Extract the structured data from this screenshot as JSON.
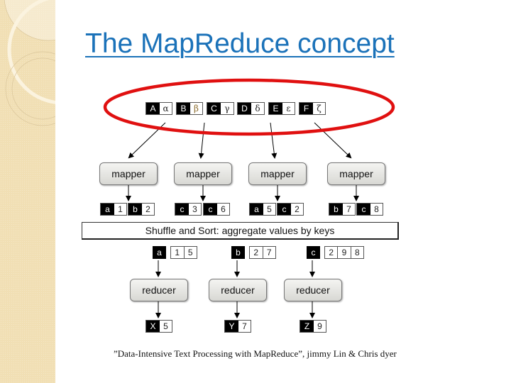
{
  "slide": {
    "title": "The MapReduce concept",
    "caption": "”Data-Intensive Text Processing with MapReduce”, jimmy Lin & Chris dyer",
    "colors": {
      "title": "#1b72b9",
      "highlight_ellipse": "#e01010",
      "background_strip": "#f1dfb4"
    }
  },
  "diagram": {
    "inputs": [
      {
        "key": "A",
        "value": "α"
      },
      {
        "key": "B",
        "value": "β"
      },
      {
        "key": "C",
        "value": "γ"
      },
      {
        "key": "D",
        "value": "δ"
      },
      {
        "key": "E",
        "value": "ε"
      },
      {
        "key": "F",
        "value": "ζ"
      }
    ],
    "mappers": [
      {
        "label": "mapper",
        "outputs": [
          {
            "key": "a",
            "value": "1"
          },
          {
            "key": "b",
            "value": "2"
          }
        ]
      },
      {
        "label": "mapper",
        "outputs": [
          {
            "key": "c",
            "value": "3"
          },
          {
            "key": "c",
            "value": "6"
          }
        ]
      },
      {
        "label": "mapper",
        "outputs": [
          {
            "key": "a",
            "value": "5"
          },
          {
            "key": "c",
            "value": "2"
          }
        ]
      },
      {
        "label": "mapper",
        "outputs": [
          {
            "key": "b",
            "value": "7"
          },
          {
            "key": "c",
            "value": "8"
          }
        ]
      }
    ],
    "shuffle_label": "Shuffle and Sort: aggregate values by keys",
    "groups": [
      {
        "key": "a",
        "values": [
          "1",
          "5"
        ]
      },
      {
        "key": "b",
        "values": [
          "2",
          "7"
        ]
      },
      {
        "key": "c",
        "values": [
          "2",
          "9",
          "8"
        ]
      }
    ],
    "reducers": [
      {
        "label": "reducer",
        "output": {
          "key": "X",
          "value": "5"
        }
      },
      {
        "label": "reducer",
        "output": {
          "key": "Y",
          "value": "7"
        }
      },
      {
        "label": "reducer",
        "output": {
          "key": "Z",
          "value": "9"
        }
      }
    ]
  }
}
